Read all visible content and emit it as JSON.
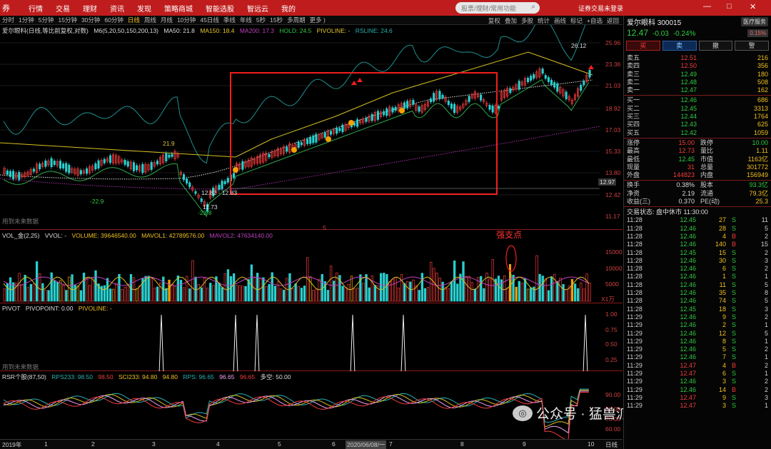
{
  "topbar": {
    "logo": "券",
    "menu": [
      "行情",
      "交易",
      "理财",
      "资讯",
      "发现",
      "策略商城",
      "智能选股",
      "智远云",
      "我的"
    ],
    "search_placeholder": "股票/理财/常用功能",
    "login": "证券交易未登录",
    "win": [
      "—",
      "□",
      "✕"
    ]
  },
  "periods": [
    "分时",
    "1分钟",
    "5分钟",
    "15分钟",
    "30分钟",
    "60分钟",
    "日线",
    "周线",
    "月线",
    "10分钟",
    "45日线",
    "季线",
    "年线",
    "5秒",
    "15秒",
    "多周期",
    "更多 )"
  ],
  "active_period": "日线",
  "tools": [
    "复权",
    "叠加",
    "多股",
    "统计",
    "画线",
    "标记",
    "+自选",
    "返回"
  ],
  "main_legend": {
    "name": "爱尔眼科(日线,等比前复权,对数)",
    "ma": "M6(5,20,50,150,200,13)",
    "ma50": "MA50: 21.8",
    "ma150": "MA150: 18.4",
    "ma200": "MA200: 17.3",
    "pivo": "PIVOLINE: -",
    "hold": "HOLD: 24.5",
    "rsline": "RSLINE: 24.6"
  },
  "price_axis": [
    "25.96",
    "23.36",
    "21.03",
    "18.92",
    "17.03",
    "15.33",
    "13.80",
    "12.42",
    "11.17"
  ],
  "annotations": {
    "hi1": "21.9",
    "lo1": "-22.9",
    "range": "12.82 - 12.83",
    "lo2": "11.73",
    "lo3": "-23.8",
    "last": "26.12",
    "cur": "12.97",
    "nodata": "用到未来数据",
    "marker": "5"
  },
  "vol_legend": {
    "name": "VOL_金(2,25)",
    "vvol": "VVOL: -",
    "volume": "VOLUME: 39646540.00",
    "mavol1": "MAVOL1: 42789576.00",
    "mavol2": "MAVOL2: 47634140.00"
  },
  "vol_axis": [
    "15000",
    "10000",
    "5000"
  ],
  "vol_unit": "X1万",
  "strong_label": "强支点",
  "pivot_legend": {
    "name": "PIVOT",
    "point": "PIVOPOINT: 0.00",
    "line": "PIVOLINE: -"
  },
  "pivot_axis": [
    "1.00",
    "0.75",
    "0.50",
    "0.25"
  ],
  "rsr_legend": {
    "name": "RSR个股(87,50)",
    "rps233": "RPS233: 98.50",
    "v1": "98.50",
    "sci": "SCI233: 94.80",
    "v2": "94.80",
    "rps": "RPS: 96.65",
    "v3": "96.65",
    "v4": "96.65",
    "dk": "多空: 50.00"
  },
  "rsr_axis": [
    "90.00",
    "80.00",
    "70.00",
    "60.00"
  ],
  "xaxis": [
    "2019年",
    "1",
    "2",
    "3",
    "4",
    "5",
    "6",
    "2020/06/08/一",
    "7",
    "8",
    "9",
    "10"
  ],
  "xaxis_right": "日线",
  "watermark": "公众号 · 猛兽派选股",
  "quote": {
    "title": "爱尔眼科 300015",
    "tag": "医疗服务",
    "sub": "R  300",
    "price": "12.47",
    "chg": "-0.03",
    "pct": "-0.24%",
    "pct2": "0.15%"
  },
  "trade_btns": [
    "买",
    "卖",
    "撤",
    "警"
  ],
  "asks": [
    [
      "卖五",
      "12.51",
      "216"
    ],
    [
      "卖四",
      "12.50",
      "356"
    ],
    [
      "卖三",
      "12.49",
      "180"
    ],
    [
      "卖二",
      "12.48",
      "508"
    ],
    [
      "卖一",
      "12.47",
      "162"
    ]
  ],
  "bids": [
    [
      "买一",
      "12.46",
      "686"
    ],
    [
      "买二",
      "12.45",
      "3313"
    ],
    [
      "买三",
      "12.44",
      "1764"
    ],
    [
      "买四",
      "12.43",
      "625"
    ],
    [
      "买五",
      "12.42",
      "1059"
    ]
  ],
  "stats1": [
    [
      "涨停",
      "15.00",
      "跌停",
      "10.00"
    ],
    [
      "最高",
      "12.73",
      "量比",
      "1.11"
    ],
    [
      "最低",
      "12.45",
      "市值",
      "1163亿"
    ],
    [
      "现量",
      "31",
      "总量",
      "301772"
    ],
    [
      "外盘",
      "144823",
      "内盘",
      "156949"
    ]
  ],
  "stats2": [
    [
      "换手",
      "0.38%",
      "股本",
      "93.3亿"
    ],
    [
      "净资",
      "2.19",
      "流通",
      "79.3亿"
    ],
    [
      "收益(三)",
      "0.370",
      "PE(动)",
      "25.3"
    ]
  ],
  "status": "交易状态: 盘中休市 11:30:00",
  "trades": [
    [
      "11:28",
      "12.45",
      "27",
      "S",
      "11"
    ],
    [
      "11:28",
      "12.46",
      "28",
      "S",
      "5"
    ],
    [
      "11:28",
      "12.46",
      "4",
      "B",
      "2"
    ],
    [
      "11:28",
      "12.46",
      "140",
      "B",
      "15"
    ],
    [
      "11:28",
      "12.45",
      "15",
      "S",
      "2"
    ],
    [
      "11:28",
      "12.46",
      "30",
      "S",
      "3"
    ],
    [
      "11:28",
      "12.46",
      "6",
      "S",
      "2"
    ],
    [
      "11:28",
      "12.46",
      "1",
      "S",
      "1"
    ],
    [
      "11:28",
      "12.46",
      "11",
      "S",
      "5"
    ],
    [
      "11:28",
      "12.46",
      "35",
      "S",
      "8"
    ],
    [
      "11:28",
      "12.46",
      "74",
      "S",
      "5"
    ],
    [
      "11:28",
      "12.45",
      "18",
      "S",
      "3"
    ],
    [
      "11:29",
      "12.46",
      "9",
      "S",
      "2"
    ],
    [
      "11:29",
      "12.46",
      "2",
      "S",
      "1"
    ],
    [
      "11:29",
      "12.46",
      "12",
      "S",
      "5"
    ],
    [
      "11:29",
      "12.46",
      "8",
      "S",
      "1"
    ],
    [
      "11:29",
      "12.46",
      "5",
      "S",
      "2"
    ],
    [
      "11:29",
      "12.46",
      "7",
      "S",
      "1"
    ],
    [
      "11:29",
      "12.47",
      "4",
      "B",
      "2"
    ],
    [
      "11:29",
      "12.47",
      "6",
      "S",
      "1"
    ],
    [
      "11:29",
      "12.46",
      "3",
      "S",
      "2"
    ],
    [
      "11:29",
      "12.46",
      "14",
      "B",
      "2"
    ],
    [
      "11:29",
      "12.47",
      "9",
      "S",
      "3"
    ],
    [
      "11:29",
      "12.47",
      "3",
      "S",
      "1"
    ]
  ]
}
